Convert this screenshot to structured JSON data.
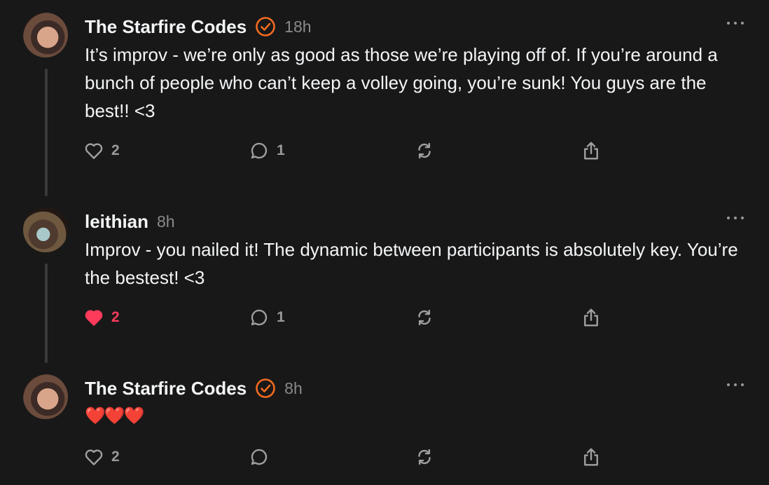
{
  "posts": [
    {
      "username": "The Starfire Codes",
      "verified": true,
      "time": "18h",
      "text": "It’s improv - we’re only as good as those we’re playing off of. If you’re around a bunch of people who can’t keep a volley going, you’re sunk! You guys are the best!! <3",
      "likes": "2",
      "liked": false,
      "replies": "1"
    },
    {
      "username": "leithian",
      "verified": false,
      "time": "8h",
      "text": "Improv - you nailed it! The dynamic between participants is absolutely key. You’re the bestest! <3",
      "likes": "2",
      "liked": true,
      "replies": "1"
    },
    {
      "username": "The Starfire Codes",
      "verified": true,
      "time": "8h",
      "text": "❤️❤️❤️",
      "likes": "2",
      "liked": false,
      "replies": ""
    }
  ],
  "colors": {
    "background": "#181818",
    "verified_badge": "#f26a21",
    "liked_heart": "#ff3b5c",
    "thread_line": "#3a3a3a"
  },
  "icons": [
    "heart-icon",
    "comment-icon",
    "repost-icon",
    "share-icon",
    "more-icon",
    "verified-icon"
  ]
}
